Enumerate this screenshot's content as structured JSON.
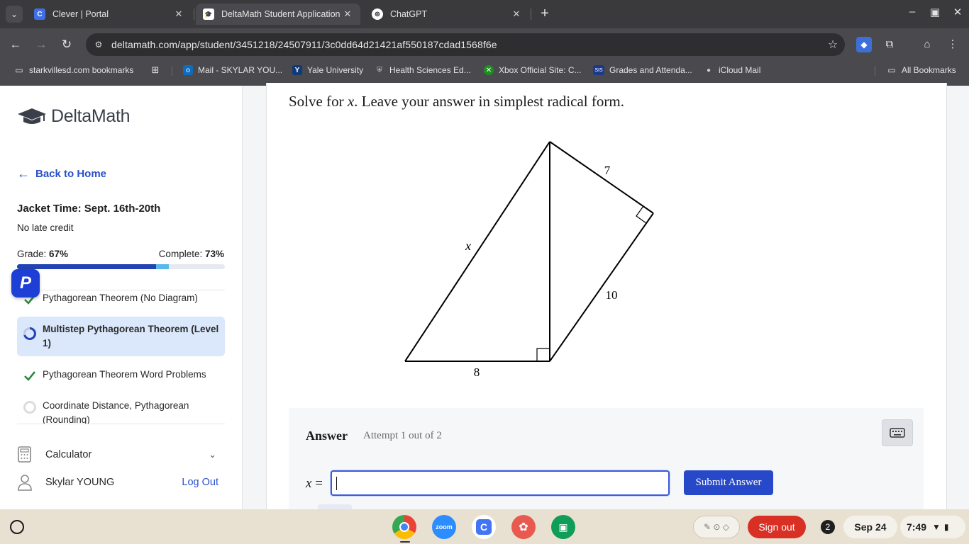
{
  "browser": {
    "tabs": [
      {
        "label": "Clever | Portal",
        "active": false,
        "favicon_text": "C"
      },
      {
        "label": "DeltaMath Student Application",
        "active": true,
        "favicon_text": "🎓"
      },
      {
        "label": "ChatGPT",
        "active": false,
        "favicon_text": "⊛"
      }
    ],
    "url": "deltamath.com/app/student/3451218/24507911/3c0dd64d21421af550187cdad1568f6e",
    "bookmarks": [
      {
        "label": "starkvillesd.com bookmarks",
        "icon": "folder-icon"
      },
      {
        "label": "Mail - SKYLAR YOU...",
        "icon": "outlook-icon"
      },
      {
        "label": "Yale University",
        "icon": "yale-icon"
      },
      {
        "label": "Health Sciences Ed...",
        "icon": "shield-icon"
      },
      {
        "label": "Xbox Official Site: C...",
        "icon": "xbox-icon"
      },
      {
        "label": "Grades and Attenda...",
        "icon": "sis-icon"
      },
      {
        "label": "iCloud Mail",
        "icon": "apple-icon"
      }
    ],
    "all_bookmarks": "All Bookmarks"
  },
  "sidebar": {
    "brand": "DeltaMath",
    "back": "Back to Home",
    "assignment_title": "Jacket Time: Sept. 16th-20th",
    "late_policy": "No late credit",
    "grade_label": "Grade: ",
    "grade_value": "67%",
    "complete_label": "Complete: ",
    "complete_value": "73%",
    "grade_fraction": 0.67,
    "complete_fraction": 0.73,
    "skills": [
      {
        "label": "Pythagorean Theorem (No Diagram)",
        "status": "done"
      },
      {
        "label": "Multistep Pythagorean Theorem (Level 1)",
        "status": "current"
      },
      {
        "label": "Pythagorean Theorem Word Problems",
        "status": "done"
      },
      {
        "label": "Coordinate Distance, Pythagorean (Rounding)",
        "status": "not-started"
      }
    ],
    "calculator": "Calculator",
    "user_name": "Skylar YOUNG",
    "logout": "Log Out"
  },
  "problem": {
    "prompt_pre": "Solve for ",
    "prompt_var": "x",
    "prompt_post": ". Leave your answer in simplest radical form.",
    "diagram_labels": {
      "top_side": "7",
      "right_side": "10",
      "bottom": "8",
      "hypotenuse": "x"
    },
    "answer_title": "Answer",
    "attempt": "Attempt 1 out of 2",
    "input_var": "x",
    "input_eq": "=",
    "input_value": "",
    "submit": "Submit Answer"
  },
  "shelf": {
    "apps": [
      "Chrome",
      "Zoom",
      "Clever",
      "Paint",
      "Classroom"
    ],
    "signout": "Sign out",
    "notifications": "2",
    "date": "Sep 24",
    "time": "7:49"
  },
  "colors": {
    "accent": "#2748c8",
    "link": "#2b50c8",
    "progress_grade": "#2343b3",
    "progress_complete": "#5bb8ea",
    "current_skill_bg": "#dbe8fb",
    "check": "#2e8a3e",
    "signout": "#d93025"
  }
}
